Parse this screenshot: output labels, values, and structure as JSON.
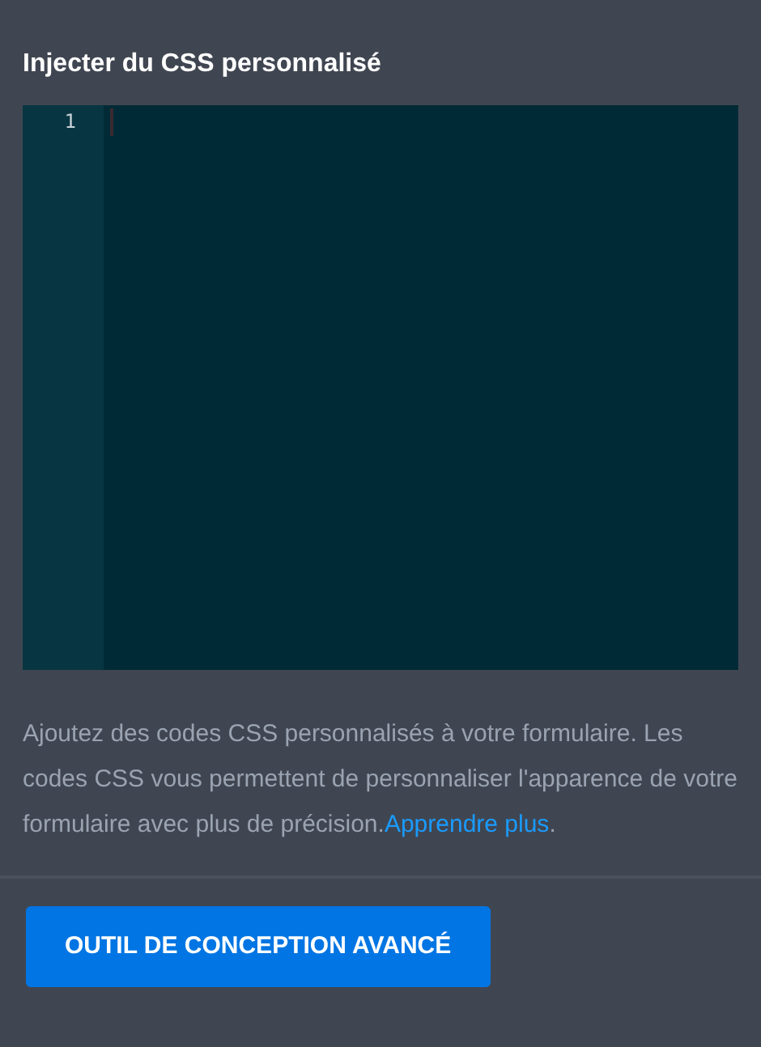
{
  "title": "Injecter du CSS personnalisé",
  "editor": {
    "line_numbers": [
      "1"
    ]
  },
  "description": {
    "text": "Ajoutez des codes CSS personnalisés à votre formulaire. Les codes CSS vous permettent de personnaliser l'apparence de votre formulaire avec plus de précision.",
    "link": "Apprendre plus",
    "after": "."
  },
  "button": "OUTIL DE CONCEPTION AVANCÉ"
}
